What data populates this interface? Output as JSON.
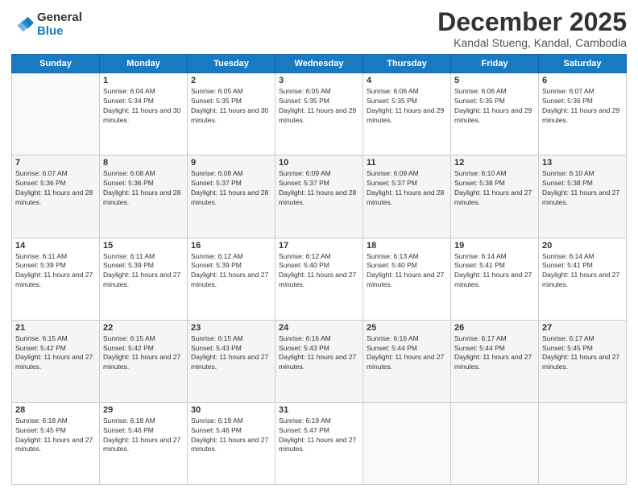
{
  "logo": {
    "general": "General",
    "blue": "Blue"
  },
  "title": "December 2025",
  "subtitle": "Kandal Stueng, Kandal, Cambodia",
  "days_of_week": [
    "Sunday",
    "Monday",
    "Tuesday",
    "Wednesday",
    "Thursday",
    "Friday",
    "Saturday"
  ],
  "weeks": [
    [
      {
        "day": "",
        "sunrise": "",
        "sunset": "",
        "daylight": ""
      },
      {
        "day": "1",
        "sunrise": "6:04 AM",
        "sunset": "5:34 PM",
        "daylight": "11 hours and 30 minutes."
      },
      {
        "day": "2",
        "sunrise": "6:05 AM",
        "sunset": "5:35 PM",
        "daylight": "11 hours and 30 minutes."
      },
      {
        "day": "3",
        "sunrise": "6:05 AM",
        "sunset": "5:35 PM",
        "daylight": "11 hours and 29 minutes."
      },
      {
        "day": "4",
        "sunrise": "6:06 AM",
        "sunset": "5:35 PM",
        "daylight": "11 hours and 29 minutes."
      },
      {
        "day": "5",
        "sunrise": "6:06 AM",
        "sunset": "5:35 PM",
        "daylight": "11 hours and 29 minutes."
      },
      {
        "day": "6",
        "sunrise": "6:07 AM",
        "sunset": "5:36 PM",
        "daylight": "11 hours and 29 minutes."
      }
    ],
    [
      {
        "day": "7",
        "sunrise": "6:07 AM",
        "sunset": "5:36 PM",
        "daylight": "11 hours and 28 minutes."
      },
      {
        "day": "8",
        "sunrise": "6:08 AM",
        "sunset": "5:36 PM",
        "daylight": "11 hours and 28 minutes."
      },
      {
        "day": "9",
        "sunrise": "6:08 AM",
        "sunset": "5:37 PM",
        "daylight": "11 hours and 28 minutes."
      },
      {
        "day": "10",
        "sunrise": "6:09 AM",
        "sunset": "5:37 PM",
        "daylight": "11 hours and 28 minutes."
      },
      {
        "day": "11",
        "sunrise": "6:09 AM",
        "sunset": "5:37 PM",
        "daylight": "11 hours and 28 minutes."
      },
      {
        "day": "12",
        "sunrise": "6:10 AM",
        "sunset": "5:38 PM",
        "daylight": "11 hours and 27 minutes."
      },
      {
        "day": "13",
        "sunrise": "6:10 AM",
        "sunset": "5:38 PM",
        "daylight": "11 hours and 27 minutes."
      }
    ],
    [
      {
        "day": "14",
        "sunrise": "6:11 AM",
        "sunset": "5:39 PM",
        "daylight": "11 hours and 27 minutes."
      },
      {
        "day": "15",
        "sunrise": "6:11 AM",
        "sunset": "5:39 PM",
        "daylight": "11 hours and 27 minutes."
      },
      {
        "day": "16",
        "sunrise": "6:12 AM",
        "sunset": "5:39 PM",
        "daylight": "11 hours and 27 minutes."
      },
      {
        "day": "17",
        "sunrise": "6:12 AM",
        "sunset": "5:40 PM",
        "daylight": "11 hours and 27 minutes."
      },
      {
        "day": "18",
        "sunrise": "6:13 AM",
        "sunset": "5:40 PM",
        "daylight": "11 hours and 27 minutes."
      },
      {
        "day": "19",
        "sunrise": "6:14 AM",
        "sunset": "5:41 PM",
        "daylight": "11 hours and 27 minutes."
      },
      {
        "day": "20",
        "sunrise": "6:14 AM",
        "sunset": "5:41 PM",
        "daylight": "11 hours and 27 minutes."
      }
    ],
    [
      {
        "day": "21",
        "sunrise": "6:15 AM",
        "sunset": "5:42 PM",
        "daylight": "11 hours and 27 minutes."
      },
      {
        "day": "22",
        "sunrise": "6:15 AM",
        "sunset": "5:42 PM",
        "daylight": "11 hours and 27 minutes."
      },
      {
        "day": "23",
        "sunrise": "6:15 AM",
        "sunset": "5:43 PM",
        "daylight": "11 hours and 27 minutes."
      },
      {
        "day": "24",
        "sunrise": "6:16 AM",
        "sunset": "5:43 PM",
        "daylight": "11 hours and 27 minutes."
      },
      {
        "day": "25",
        "sunrise": "6:16 AM",
        "sunset": "5:44 PM",
        "daylight": "11 hours and 27 minutes."
      },
      {
        "day": "26",
        "sunrise": "6:17 AM",
        "sunset": "5:44 PM",
        "daylight": "11 hours and 27 minutes."
      },
      {
        "day": "27",
        "sunrise": "6:17 AM",
        "sunset": "5:45 PM",
        "daylight": "11 hours and 27 minutes."
      }
    ],
    [
      {
        "day": "28",
        "sunrise": "6:18 AM",
        "sunset": "5:45 PM",
        "daylight": "11 hours and 27 minutes."
      },
      {
        "day": "29",
        "sunrise": "6:18 AM",
        "sunset": "5:46 PM",
        "daylight": "11 hours and 27 minutes."
      },
      {
        "day": "30",
        "sunrise": "6:19 AM",
        "sunset": "5:46 PM",
        "daylight": "11 hours and 27 minutes."
      },
      {
        "day": "31",
        "sunrise": "6:19 AM",
        "sunset": "5:47 PM",
        "daylight": "11 hours and 27 minutes."
      },
      {
        "day": "",
        "sunrise": "",
        "sunset": "",
        "daylight": ""
      },
      {
        "day": "",
        "sunrise": "",
        "sunset": "",
        "daylight": ""
      },
      {
        "day": "",
        "sunrise": "",
        "sunset": "",
        "daylight": ""
      }
    ]
  ]
}
